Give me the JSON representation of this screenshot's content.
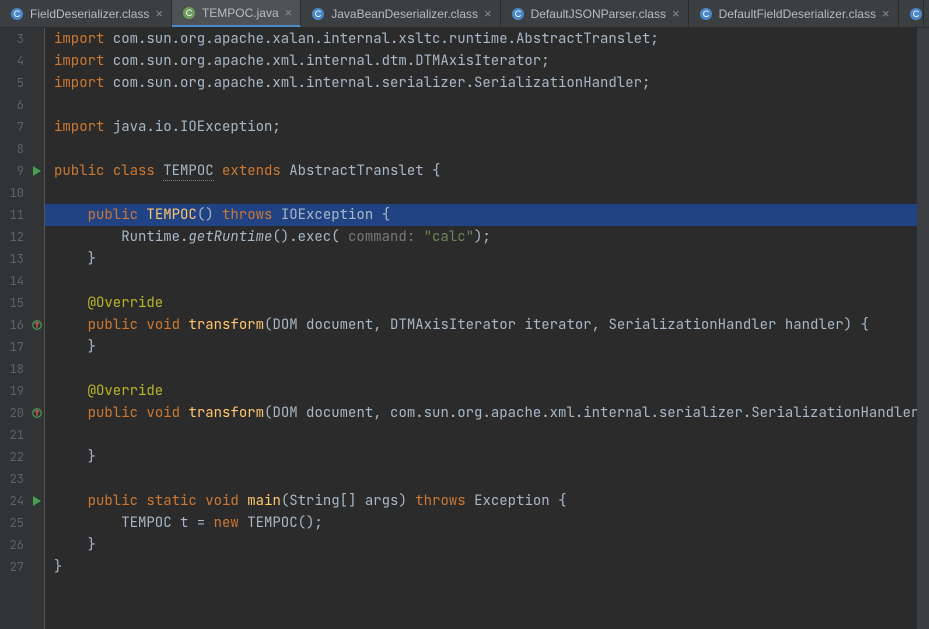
{
  "tabs": [
    {
      "label": "FieldDeserializer.class",
      "active": false,
      "icon": "class"
    },
    {
      "label": "TEMPOC.java",
      "active": true,
      "icon": "java"
    },
    {
      "label": "JavaBeanDeserializer.class",
      "active": false,
      "icon": "class"
    },
    {
      "label": "DefaultJSONParser.class",
      "active": false,
      "icon": "class"
    },
    {
      "label": "DefaultFieldDeserializer.class",
      "active": false,
      "icon": "class"
    }
  ],
  "gutter": {
    "start": 3,
    "end": 27,
    "marks": {
      "9": "run",
      "11": "caret",
      "16": "override",
      "20": "override",
      "24": "run"
    }
  },
  "code": {
    "import_kw": "import",
    "imports": [
      "com.sun.org.apache.xalan.internal.xsltc.runtime.AbstractTranslet",
      "com.sun.org.apache.xml.internal.dtm.DTMAxisIterator",
      "com.sun.org.apache.xml.internal.serializer.SerializationHandler"
    ],
    "import_io": "java.io.IOException",
    "public": "public",
    "class_kw": "class",
    "extends_kw": "extends",
    "void_kw": "void",
    "static_kw": "static",
    "new_kw": "new",
    "throws_kw": "throws",
    "class_name": "TEMPOC",
    "super_name": "AbstractTranslet",
    "ctor_sig_open": "(",
    "ctor_sig_close": ")",
    "brace_open": "{",
    "brace_close": "}",
    "ioexception": "IOException",
    "runtime_call_a": "Runtime.",
    "runtime_call_b": "getRuntime",
    "runtime_call_c": "().exec(",
    "command_hint": "command:",
    "calc": "\"calc\"",
    "exec_tail": ");",
    "override": "@Override",
    "transform": "transform",
    "sig1_a": "(DOM document",
    "sig1_b": "DTMAxisIterator iterator",
    "sig1_c": "SerializationHandler handler",
    "sig2_a": "(DOM document",
    "sig2_b": "com.sun.org.apache.xml.internal.serializer.SerializationHandler[] ha",
    "main": "main",
    "main_args": "(String[] args)",
    "exception": "Exception",
    "local_decl_a": "TEMPOC ",
    "local_var": "t",
    "local_decl_b": " = ",
    "ctor_call": "TEMPOC();",
    "comma": ", ",
    "semi": ";"
  }
}
